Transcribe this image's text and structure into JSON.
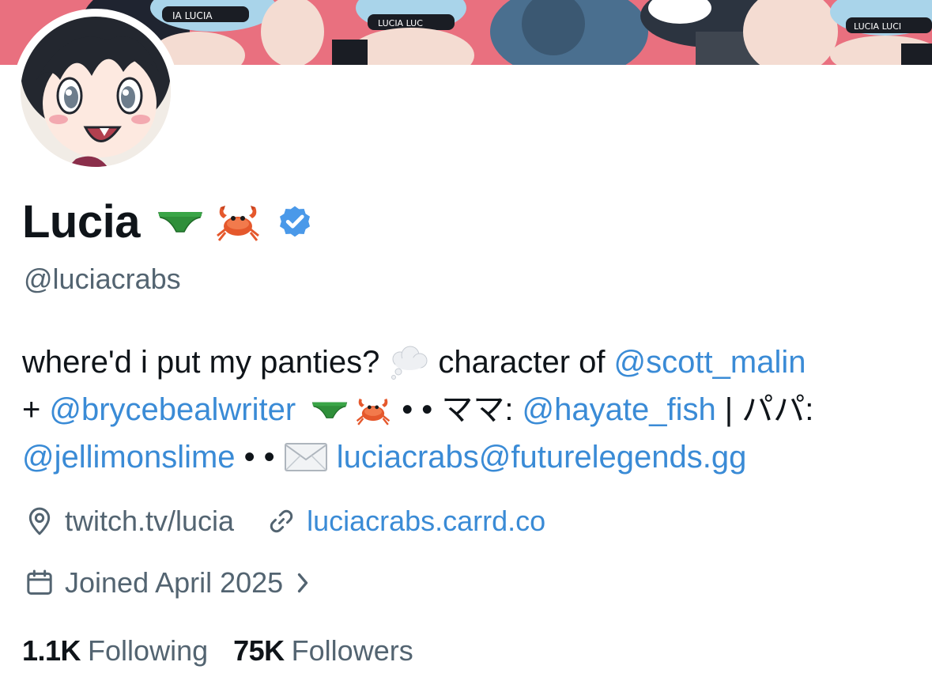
{
  "profile": {
    "display_name": "Lucia",
    "name_emojis": [
      "green-briefs-emoji",
      "crab-emoji"
    ],
    "verified": true,
    "handle": "@luciacrabs",
    "banner_texts": [
      "IA LUCIA",
      "LUCIA LUC",
      "LUCIA LUCI"
    ]
  },
  "bio": {
    "line1": {
      "t1": "where'd i put my panties?",
      "t2": "character of",
      "m1": "@scott_malin"
    },
    "line2": {
      "t1": "+",
      "m1": "@brycebealwriter",
      "t2": "• • ママ:",
      "m2": "@hayate_fish",
      "t3": "| パパ:"
    },
    "line3": {
      "m1": "@jellimonslime",
      "t1": "• •",
      "email": "luciacrabs@futurelegends.gg"
    }
  },
  "meta": {
    "location": "twitch.tv/lucia",
    "website": "luciacrabs.carrd.co",
    "joined": "Joined April 2025"
  },
  "stats": {
    "following_count": "1.1K",
    "following_label": "Following",
    "followers_count": "75K",
    "followers_label": "Followers"
  },
  "colors": {
    "link": "#3a8bd6",
    "muted": "#536471",
    "text": "#0f1419",
    "verified": "#1d9bf0"
  }
}
